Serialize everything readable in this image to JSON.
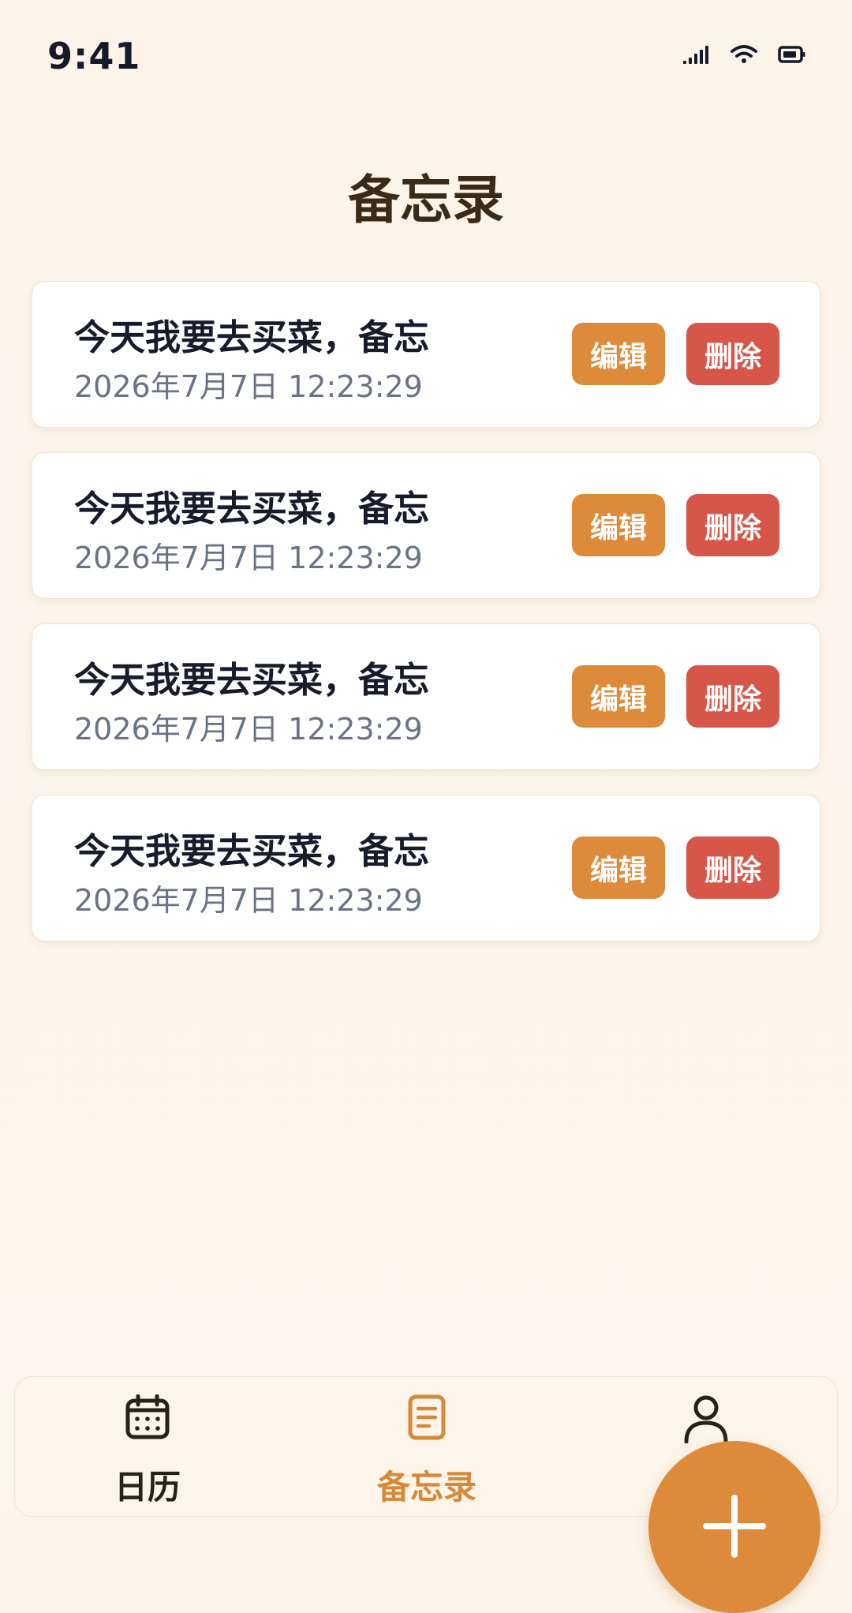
{
  "status_bar": {
    "time": "9:41",
    "icons": [
      "signal-icon",
      "wifi-icon",
      "battery-icon"
    ]
  },
  "header": {
    "title": "备忘录"
  },
  "memos": [
    {
      "title": "今天我要去买菜，备忘",
      "time": "2026年7月7日 12:23:29",
      "edit_label": "编辑",
      "delete_label": "删除"
    },
    {
      "title": "今天我要去买菜，备忘",
      "time": "2026年7月7日 12:23:29",
      "edit_label": "编辑",
      "delete_label": "删除"
    },
    {
      "title": "今天我要去买菜，备忘",
      "time": "2026年7月7日 12:23:29",
      "edit_label": "编辑",
      "delete_label": "删除"
    },
    {
      "title": "今天我要去买菜，备忘",
      "time": "2026年7月7日 12:23:29",
      "edit_label": "编辑",
      "delete_label": "删除"
    }
  ],
  "tab_bar": {
    "tabs": [
      {
        "label": "日历",
        "icon": "calendar-icon",
        "active": false
      },
      {
        "label": "备忘录",
        "icon": "document-icon",
        "active": true
      },
      {
        "label": "",
        "icon": "user-icon",
        "active": false
      }
    ]
  },
  "fab": {
    "icon": "plus-icon"
  },
  "colors": {
    "accent": "#dd8b3b",
    "danger": "#d6574a",
    "background": "#fcf4e9",
    "title_text": "#3b2a18"
  }
}
